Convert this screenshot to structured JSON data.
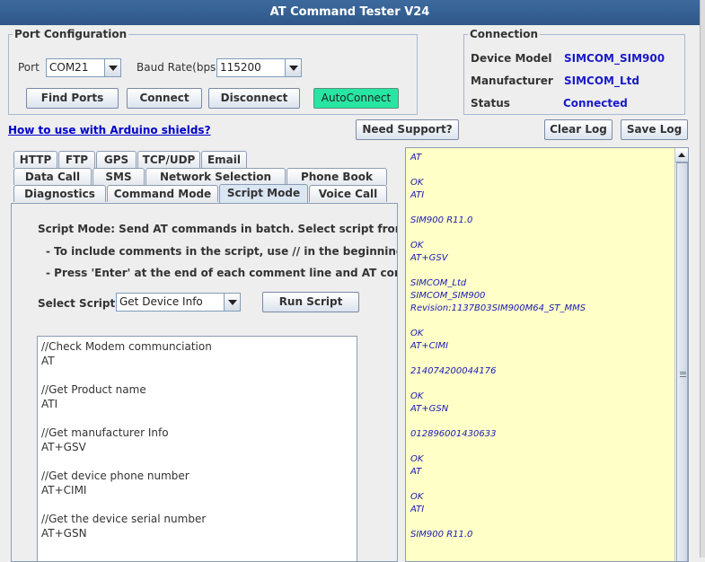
{
  "window": {
    "title": "AT Command Tester V24"
  },
  "port_config": {
    "legend": "Port Configuration",
    "port_label": "Port",
    "port_value": "COM21",
    "baud_label": "Baud Rate(bps)",
    "baud_value": "115200",
    "find_ports": "Find Ports",
    "connect": "Connect",
    "disconnect": "Disconnect",
    "autoconnect": "AutoConnect"
  },
  "connection": {
    "legend": "Connection",
    "device_model_label": "Device Model",
    "device_model_value": "SIMCOM_SIM900",
    "manufacturer_label": "Manufacturer",
    "manufacturer_value": "SIMCOM_Ltd",
    "status_label": "Status",
    "status_value": "Connected"
  },
  "toolbar": {
    "arduino_link": "How to use with Arduino shields?",
    "need_support": "Need Support?",
    "clear_log": "Clear Log",
    "save_log": "Save Log"
  },
  "tabs": {
    "row1": [
      "HTTP",
      "FTP",
      "GPS",
      "TCP/UDP",
      "Email"
    ],
    "row2": [
      "Data Call",
      "SMS",
      "Network Selection",
      "Phone Book"
    ],
    "row3": [
      "Diagnostics",
      "Command Mode",
      "Script Mode",
      "Voice Call"
    ],
    "active": "Script Mode"
  },
  "script_mode": {
    "intro": "Script Mode: Send AT commands in batch. Select script from the drop",
    "note1": "- To include comments in the script, use // in the beginning of the line",
    "note2": "- Press 'Enter' at the end of each comment line and AT command line",
    "select_label": "Select Script",
    "select_value": "Get Device Info",
    "run_script": "Run Script",
    "editor_lines": [
      "//Check Modem communciation",
      "AT",
      "",
      "//Get Product name",
      "ATI",
      "",
      "//Get manufacturer Info",
      "AT+GSV",
      "",
      "//Get device phone number",
      "AT+CIMI",
      "",
      "//Get the device serial number",
      "AT+GSN",
      "",
      ""
    ]
  },
  "log": {
    "lines": [
      "AT",
      "",
      "OK",
      "ATI",
      "",
      "SIM900 R11.0",
      "",
      "OK",
      "AT+GSV",
      "",
      "SIMCOM_Ltd",
      "SIMCOM_SIM900",
      "Revision:1137B03SIM900M64_ST_MMS",
      "",
      "OK",
      "AT+CIMI",
      "",
      "214074200044176",
      "",
      "OK",
      "AT+GSN",
      "",
      "012896001430633",
      "",
      "OK",
      "AT",
      "",
      "OK",
      "ATI",
      "",
      "SIM900 R11.0",
      "",
      ""
    ]
  },
  "colors": {
    "titlebar": "#2f5788",
    "autoconnect": "#27e6a3",
    "log_background": "#ffffc8",
    "value_text": "#1a1ac8"
  }
}
